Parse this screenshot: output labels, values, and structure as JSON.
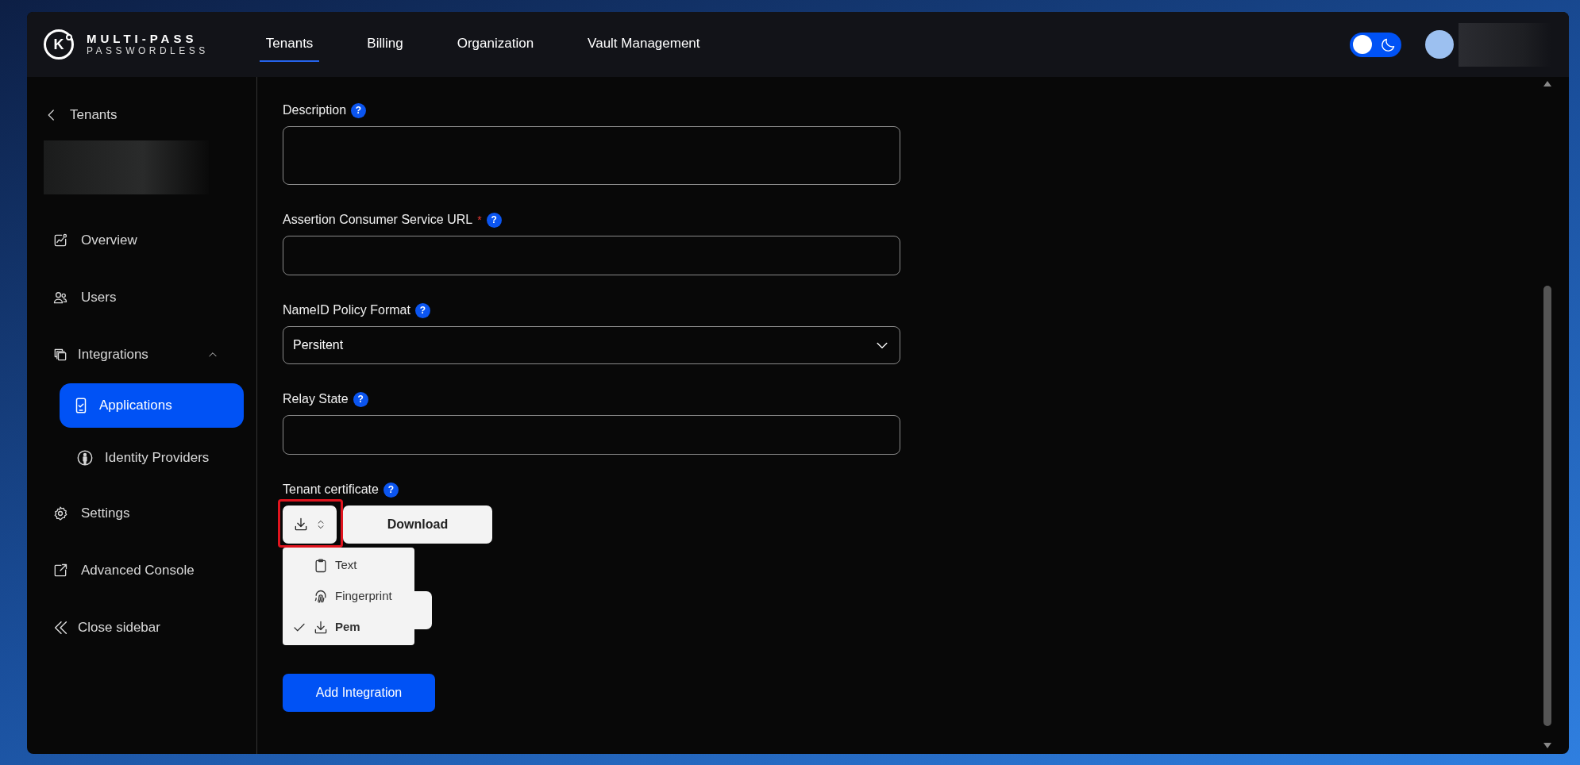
{
  "brand": {
    "name": "MULTI-PASS",
    "tagline": "PASSWORDLESS",
    "mark": "K"
  },
  "nav_tabs": [
    {
      "label": "Tenants",
      "selected": true
    },
    {
      "label": "Billing",
      "selected": false
    },
    {
      "label": "Organization",
      "selected": false
    },
    {
      "label": "Vault Management",
      "selected": false
    }
  ],
  "theme_toggle": {
    "on": false
  },
  "sidebar": {
    "back": "Tenants",
    "items": [
      {
        "label": "Overview",
        "kind": "chart",
        "selected": false
      },
      {
        "label": "Users",
        "kind": "users",
        "selected": false
      },
      {
        "label": "Integrations",
        "kind": "copies",
        "selected": false,
        "expanded": true,
        "children": [
          {
            "label": "Applications",
            "kind": "phone",
            "selected": true
          },
          {
            "label": "Identity Providers",
            "kind": "person",
            "selected": false
          }
        ]
      },
      {
        "label": "Settings",
        "kind": "gear",
        "selected": false
      },
      {
        "label": "Advanced Console",
        "kind": "external",
        "selected": false
      }
    ],
    "footer": "Close sidebar"
  },
  "form": {
    "fields": [
      {
        "label": "Description",
        "kind": "textarea",
        "help": "?"
      },
      {
        "label": "Assertion Consumer Service URL",
        "kind": "input",
        "required_mark": "*",
        "help": "?"
      },
      {
        "label": "NameID Policy Format",
        "kind": "select",
        "value": "Persitent",
        "help": "?"
      },
      {
        "label": "Relay State",
        "kind": "input",
        "help": "?"
      }
    ],
    "certificate": {
      "label": "Tenant certificate",
      "help": "?",
      "download": "Download",
      "menu_open": true,
      "menu": [
        {
          "label": "Text",
          "kind": "clipboard",
          "selected": false
        },
        {
          "label": "Fingerprint",
          "kind": "fingerprint",
          "selected": false
        },
        {
          "label": "Pem",
          "kind": "download",
          "selected": true
        }
      ]
    },
    "submit": "Add Integration"
  }
}
